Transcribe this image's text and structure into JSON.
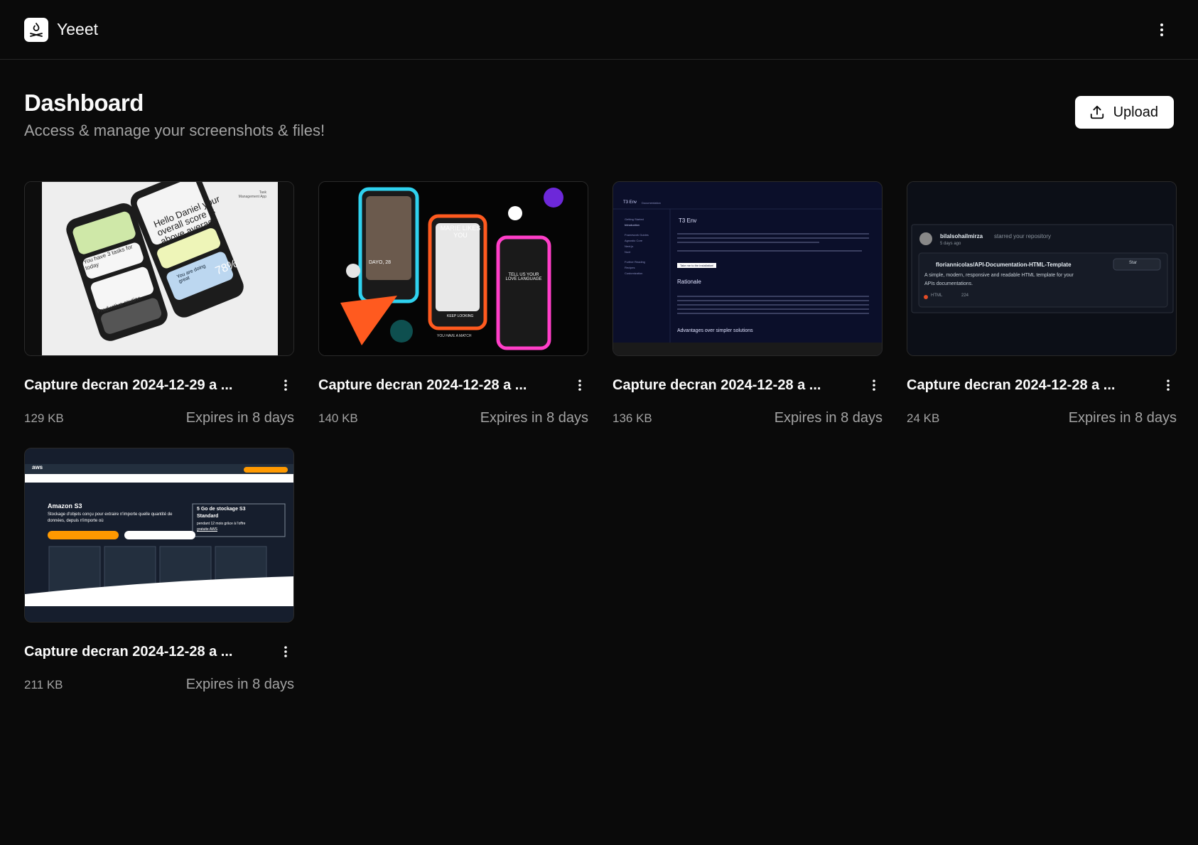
{
  "app": {
    "name": "Yeeet"
  },
  "header": {
    "title": "Dashboard",
    "subtitle": "Access & manage your screenshots & files!",
    "upload_label": "Upload"
  },
  "files": [
    {
      "title": "Capture decran 2024-12-29 a ...",
      "size": "129 KB",
      "expires": "Expires in 8 days",
      "thumb_text": [
        "Hello Daniel your overall score is above average",
        "You have 3 tasks for today",
        "78%",
        "Productive routine.",
        "You are doing great",
        "Task Management App"
      ]
    },
    {
      "title": "Capture decran 2024-12-28 a ...",
      "size": "140 KB",
      "expires": "Expires in 8 days",
      "thumb_text": [
        "DAYO, 28",
        "MARIE LIKES YOU",
        "KEEP LOOKING",
        "YOU HAVE A MATCH",
        "TELL US YOUR LOVE LANGUAGE"
      ]
    },
    {
      "title": "Capture decran 2024-12-28 a ...",
      "size": "136 KB",
      "expires": "Expires in 8 days",
      "thumb_text": [
        "T3 Env",
        "Documentation",
        "Getting Started",
        "Introduction",
        "Framework Guides",
        "Agnostic Core",
        "Next.js",
        "Nuxt",
        "Further Reading",
        "Recipes",
        "Customization",
        "Take me to the installation!",
        "Rationale",
        "Advantages over simpler solutions"
      ]
    },
    {
      "title": "Capture decran 2024-12-28 a ...",
      "size": "24 KB",
      "expires": "Expires in 8 days",
      "thumb_text": [
        "bilalsohailmirza",
        "starred your repository",
        "5 days ago",
        "floriannicolas/API-Documentation-HTML-Template",
        "A simple, modern, responsive and readable HTML template for your",
        "APIs documentations.",
        "HTML",
        "224",
        "Star"
      ]
    },
    {
      "title": "Capture decran 2024-12-28 a ...",
      "size": "211 KB",
      "expires": "Expires in 8 days",
      "thumb_text": [
        "aws",
        "Amazon S3",
        "Stockage d'objets conçu pour extraire n'importe quelle quantité de",
        "données, depuis n'importe où",
        "5 Go de stockage S3",
        "Standard",
        "pendant 12 mois grâce à l'offre",
        "gratuite AWS"
      ]
    }
  ],
  "colors": {
    "background": "#0a0a0a",
    "text": "#fafafa",
    "muted": "#a3a3a3",
    "border": "#262626"
  }
}
